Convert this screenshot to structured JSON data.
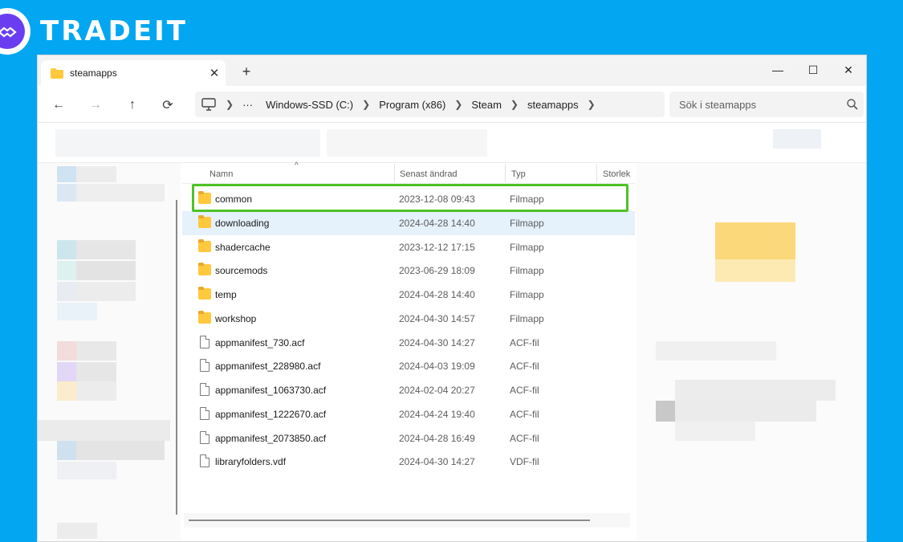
{
  "brand": {
    "name": "TRADEIT"
  },
  "window": {
    "tab_label": "steamapps",
    "controls": {
      "minimize": "—",
      "maximize": "☐",
      "close": "✕"
    }
  },
  "nav": {
    "back": "←",
    "forward": "→",
    "up": "↑",
    "refresh": "⟳",
    "breadcrumb": [
      "Windows-SSD (C:)",
      "Program (x86)",
      "Steam",
      "steamapps"
    ],
    "search_placeholder": "Sök i steamapps"
  },
  "columns": {
    "name": "Namn",
    "date": "Senast ändrad",
    "type": "Typ",
    "size": "Storlek"
  },
  "files": [
    {
      "name": "common",
      "date": "2023-12-08 09:43",
      "type": "Filmapp",
      "kind": "folder"
    },
    {
      "name": "downloading",
      "date": "2024-04-28 14:40",
      "type": "Filmapp",
      "kind": "folder"
    },
    {
      "name": "shadercache",
      "date": "2023-12-12 17:15",
      "type": "Filmapp",
      "kind": "folder"
    },
    {
      "name": "sourcemods",
      "date": "2023-06-29 18:09",
      "type": "Filmapp",
      "kind": "folder"
    },
    {
      "name": "temp",
      "date": "2024-04-28 14:40",
      "type": "Filmapp",
      "kind": "folder"
    },
    {
      "name": "workshop",
      "date": "2024-04-30 14:57",
      "type": "Filmapp",
      "kind": "folder"
    },
    {
      "name": "appmanifest_730.acf",
      "date": "2024-04-30 14:27",
      "type": "ACF-fil",
      "kind": "file"
    },
    {
      "name": "appmanifest_228980.acf",
      "date": "2024-04-03 19:09",
      "type": "ACF-fil",
      "kind": "file"
    },
    {
      "name": "appmanifest_1063730.acf",
      "date": "2024-02-04 20:27",
      "type": "ACF-fil",
      "kind": "file"
    },
    {
      "name": "appmanifest_1222670.acf",
      "date": "2024-04-24 19:40",
      "type": "ACF-fil",
      "kind": "file"
    },
    {
      "name": "appmanifest_2073850.acf",
      "date": "2024-04-28 16:49",
      "type": "ACF-fil",
      "kind": "file"
    },
    {
      "name": "libraryfolders.vdf",
      "date": "2024-04-30 14:27",
      "type": "VDF-fil",
      "kind": "file"
    }
  ],
  "highlighted_item": "common",
  "selected_item": "downloading",
  "colors": {
    "background": "#03a6f0",
    "highlight": "#4ec326",
    "folder": "#ffc83d"
  }
}
